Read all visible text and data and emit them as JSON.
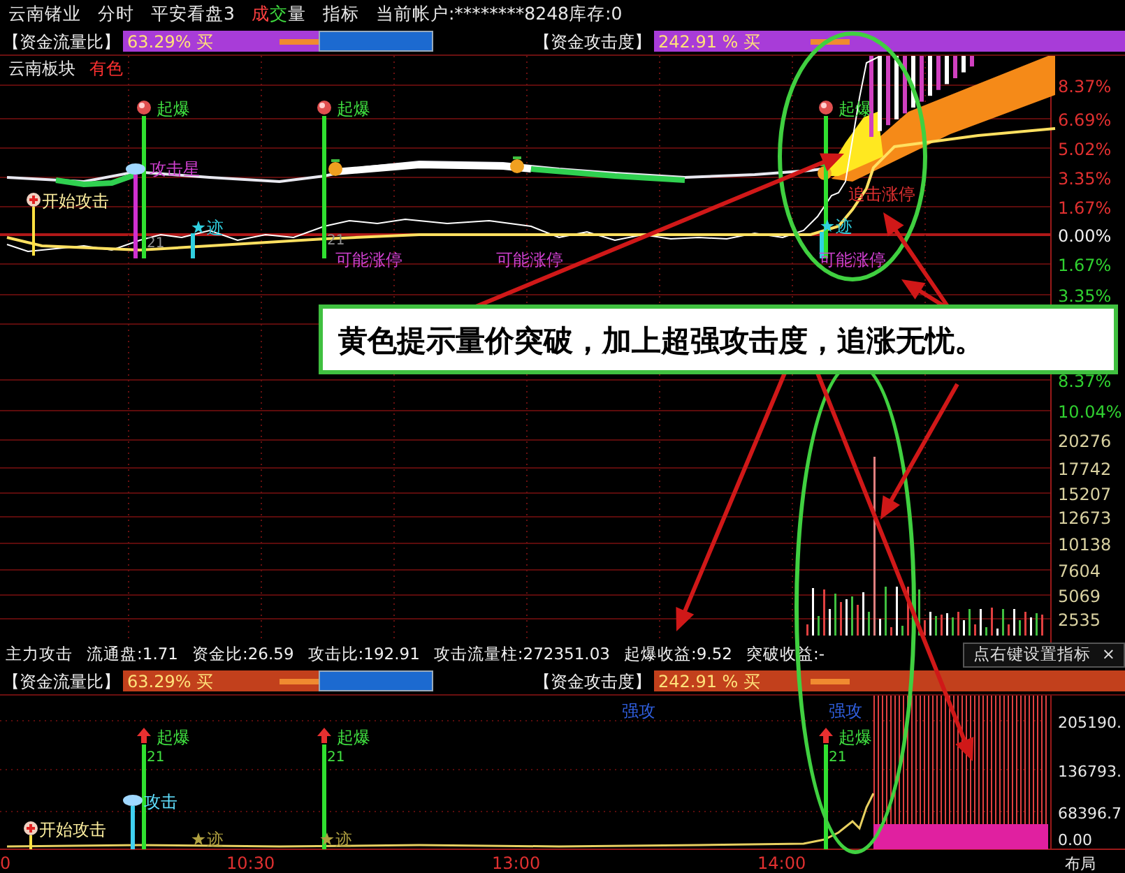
{
  "top_bar": {
    "stock": "云南锗业",
    "menu": [
      "分时",
      "平安看盘3",
      "成交量",
      "指标"
    ],
    "account": "当前帐户:********8248库存:0"
  },
  "price_panel": {
    "gauges": [
      {
        "name": "【资金流量比】",
        "value": "63.29% 买"
      },
      {
        "name": "【资金攻击度】",
        "value": "242.91 % 买"
      }
    ],
    "sector": "云南板块",
    "sector_tag": "有色",
    "signals": [
      {
        "kind": "burst",
        "text": "起爆"
      },
      {
        "kind": "burst",
        "text": "起爆"
      },
      {
        "kind": "burst",
        "text": "起爆"
      },
      {
        "kind": "star",
        "text": "攻击星"
      },
      {
        "kind": "chase",
        "text": "追击涨停"
      },
      {
        "kind": "start",
        "text": "开始攻击"
      },
      {
        "kind": "trace",
        "text": "迹"
      },
      {
        "kind": "trace",
        "text": "迹"
      },
      {
        "kind": "count",
        "text": "21"
      },
      {
        "kind": "count",
        "text": "21"
      },
      {
        "kind": "limit",
        "text": "可能涨停"
      },
      {
        "kind": "limit",
        "text": "可能涨停"
      },
      {
        "kind": "limit",
        "text": "可能涨停"
      }
    ],
    "price_axis": [
      {
        "text": "8.37%",
        "kind": "up"
      },
      {
        "text": "6.69%",
        "kind": "up"
      },
      {
        "text": "5.02%",
        "kind": "up"
      },
      {
        "text": "3.35%",
        "kind": "up"
      },
      {
        "text": "1.67%",
        "kind": "up"
      },
      {
        "text": "0.00%",
        "kind": "zero"
      },
      {
        "text": "1.67%",
        "kind": "down"
      },
      {
        "text": "3.35%",
        "kind": "down"
      },
      {
        "text": "8.37%",
        "kind": "down"
      },
      {
        "text": "10.04%",
        "kind": "down"
      }
    ],
    "volume_axis": [
      "20276",
      "17742",
      "15207",
      "12673",
      "10138",
      "7604",
      "5069",
      "2535"
    ]
  },
  "callout": "黄色提示量价突破，加上超强攻击度，追涨无忧。",
  "indicator_panel": {
    "stats": [
      "主力攻击",
      "流通盘:1.71",
      "资金比:26.59",
      "攻击比:192.91",
      "攻击流量柱:272351.03",
      "起爆收益:9.52",
      "突破收益:-"
    ],
    "hint": "点右键设置指标",
    "close": "×",
    "gauges": [
      {
        "name": "【资金流量比】",
        "value": "63.29% 买"
      },
      {
        "name": "【资金攻击度】",
        "value": "242.91 % 买"
      }
    ],
    "signals": [
      {
        "kind": "strong",
        "text": "强攻"
      },
      {
        "kind": "strong",
        "text": "强攻"
      },
      {
        "kind": "burst",
        "text": "起爆"
      },
      {
        "kind": "burst",
        "text": "起爆"
      },
      {
        "kind": "burst",
        "text": "起爆"
      },
      {
        "kind": "count",
        "text": "21"
      },
      {
        "kind": "count",
        "text": "21"
      },
      {
        "kind": "count",
        "text": "21"
      },
      {
        "kind": "strike",
        "text": "攻击"
      },
      {
        "kind": "start",
        "text": "开始攻击"
      },
      {
        "kind": "trace",
        "text": "迹"
      },
      {
        "kind": "trace",
        "text": "迹"
      }
    ],
    "value_axis": [
      "205190.",
      "136793.",
      "68396.7",
      "0.00"
    ],
    "time_axis": [
      "0",
      "10:30",
      "13:00",
      "14:00"
    ],
    "corner": "布局"
  }
}
